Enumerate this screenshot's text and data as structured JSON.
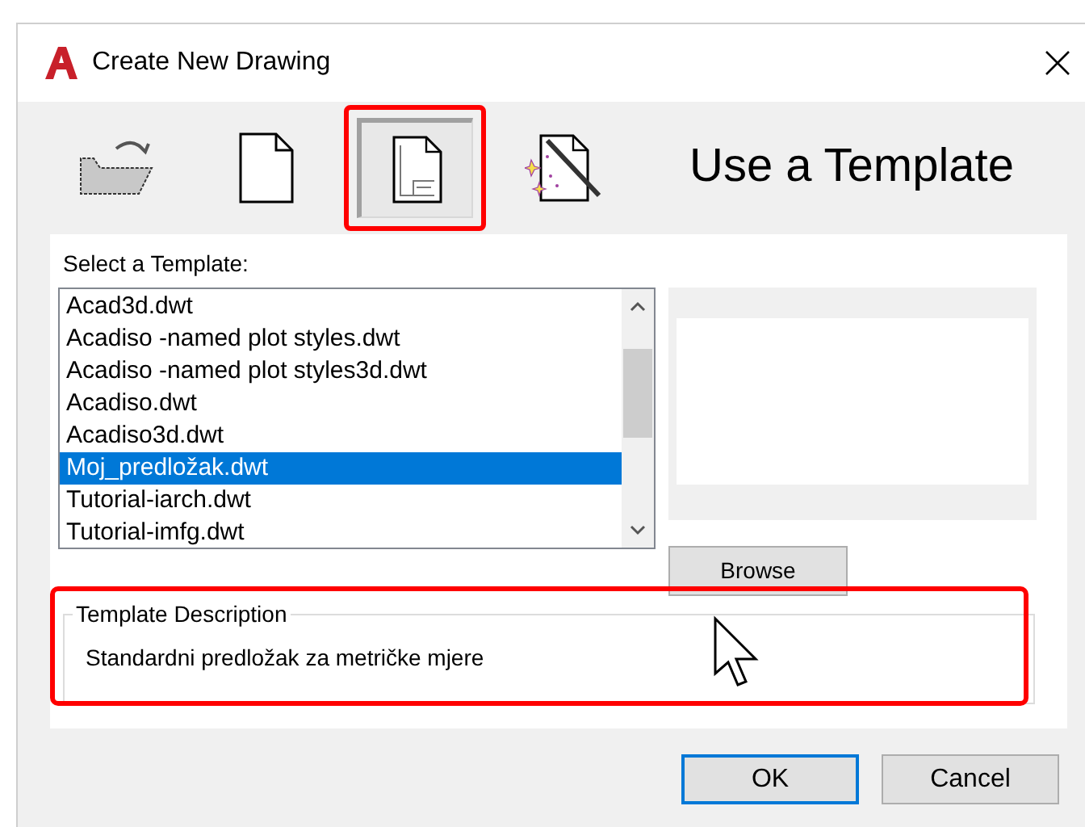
{
  "window": {
    "title": "Create New Drawing"
  },
  "toolbar": {
    "buttons": [
      {
        "kind": "open",
        "selected": false,
        "highlighted": false
      },
      {
        "kind": "blank",
        "selected": false,
        "highlighted": false
      },
      {
        "kind": "template",
        "selected": true,
        "highlighted": true
      },
      {
        "kind": "wizard",
        "selected": false,
        "highlighted": false
      }
    ],
    "heading": "Use a Template"
  },
  "template_list": {
    "label": "Select a Template:",
    "items": [
      {
        "name": "Acad3d.dwt",
        "selected": false
      },
      {
        "name": "Acadiso -named plot styles.dwt",
        "selected": false
      },
      {
        "name": "Acadiso -named plot styles3d.dwt",
        "selected": false
      },
      {
        "name": "Acadiso.dwt",
        "selected": false
      },
      {
        "name": "Acadiso3d.dwt",
        "selected": false
      },
      {
        "name": "Moj_predložak.dwt",
        "selected": true
      },
      {
        "name": "Tutorial-iarch.dwt",
        "selected": false
      },
      {
        "name": "Tutorial-imfg.dwt",
        "selected": false
      }
    ]
  },
  "browse_button": "Browse",
  "template_description": {
    "label": "Template Description",
    "text": "Standardni predložak za metričke mjere",
    "highlighted": true
  },
  "buttons": [
    {
      "label": "OK",
      "default": true
    },
    {
      "label": "Cancel",
      "default": false
    }
  ]
}
